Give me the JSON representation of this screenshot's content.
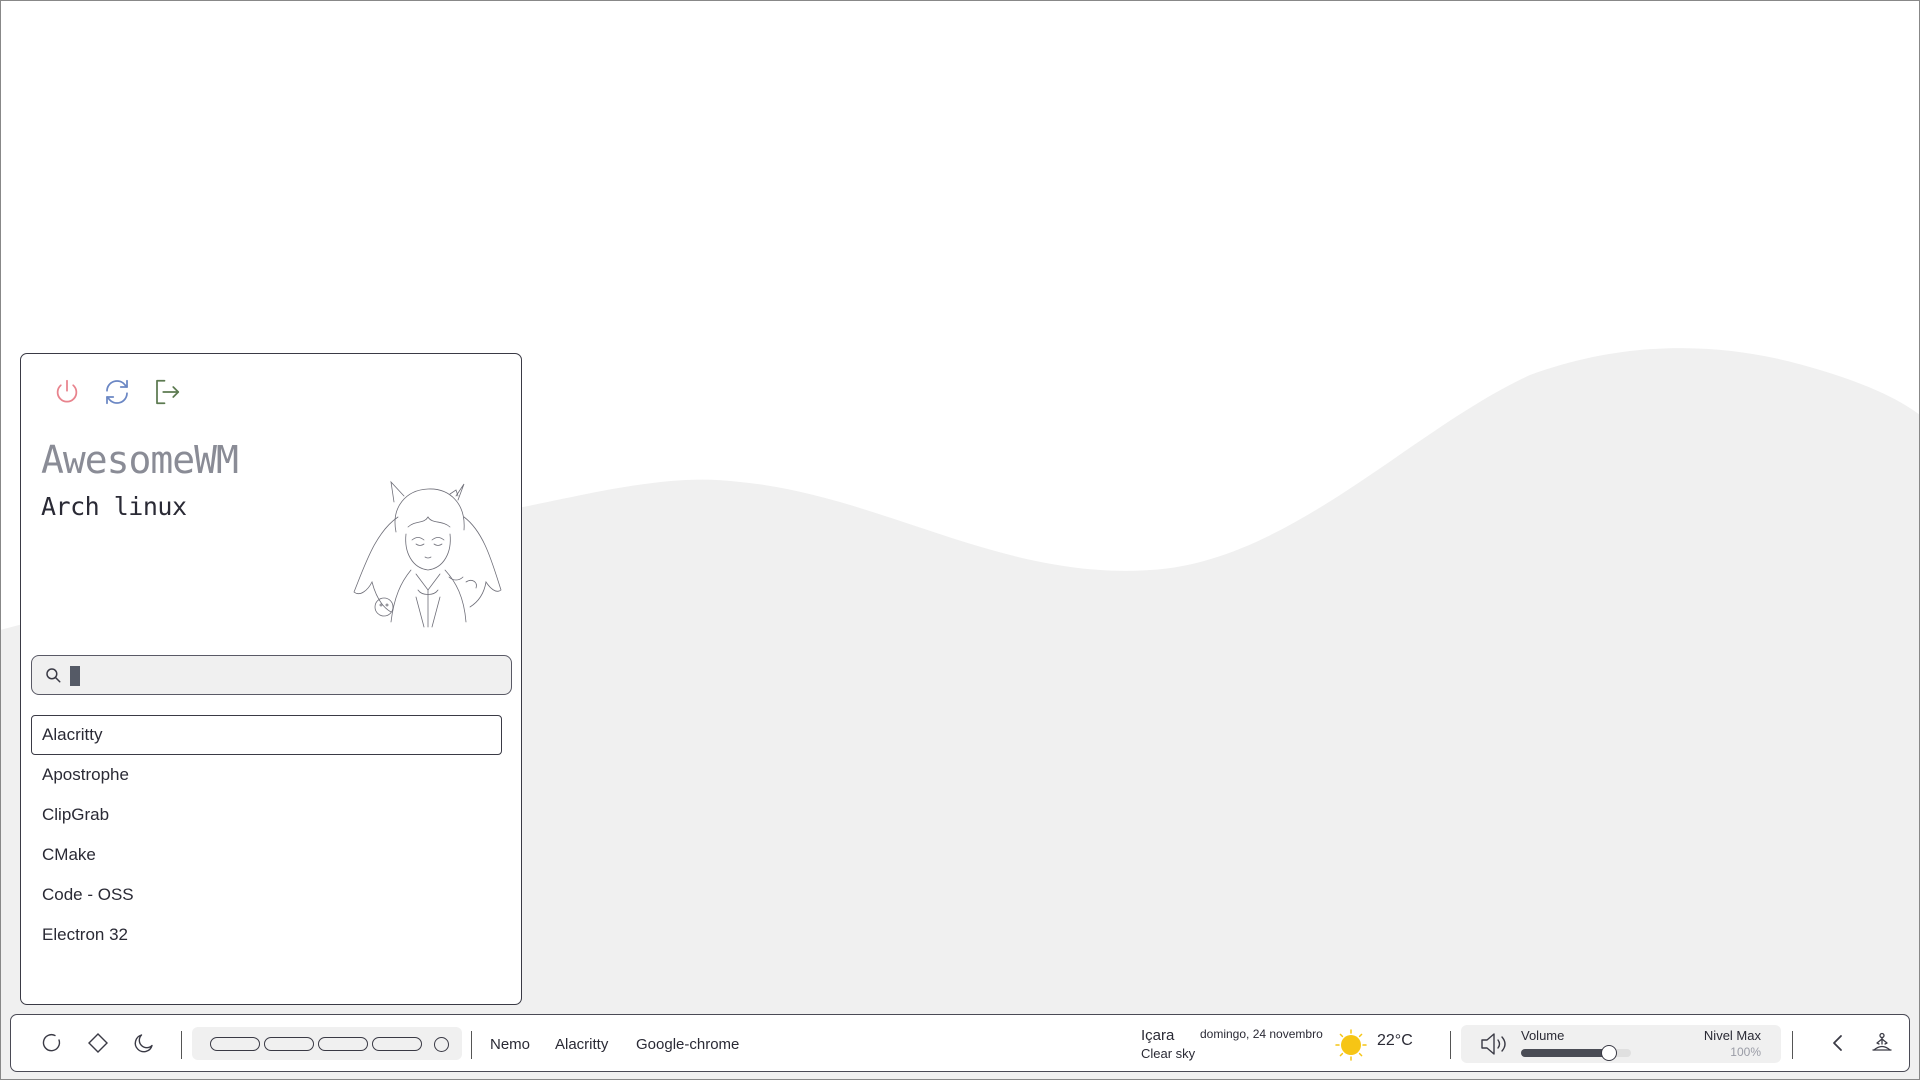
{
  "launcher": {
    "power_buttons": [
      {
        "icon": "power-icon",
        "color": "#e8838d"
      },
      {
        "icon": "refresh-icon",
        "color": "#6b87c4"
      },
      {
        "icon": "logout-icon",
        "color": "#5c7a50"
      }
    ],
    "title": "AwesomeWM",
    "subtitle": "Arch linux",
    "search": {
      "value": "",
      "placeholder": ""
    },
    "apps": [
      {
        "label": "Alacritty",
        "selected": true
      },
      {
        "label": "Apostrophe",
        "selected": false
      },
      {
        "label": "ClipGrab",
        "selected": false
      },
      {
        "label": "CMake",
        "selected": false
      },
      {
        "label": "Code - OSS",
        "selected": false
      },
      {
        "label": "Electron 32",
        "selected": false
      }
    ]
  },
  "taskbar": {
    "left_icons": [
      "circle-icon",
      "diamond-icon",
      "moon-icon"
    ],
    "tasks": [
      "Nemo",
      "Alacritty",
      "Google-chrome"
    ],
    "weather": {
      "city": "Içara",
      "description": "Clear sky",
      "temperature": "22°C",
      "icon": "sun-icon"
    },
    "date": "domingo, 24 novembro",
    "volume": {
      "label": "Volume",
      "max_label": "Nivel Max",
      "percent_text": "100%",
      "level": 0.8
    },
    "right_icons": [
      "chevron-left-icon",
      "meditate-icon"
    ]
  },
  "colors": {
    "accent": "#3a3a45",
    "wallpaper_wave": "#f0f0f0",
    "sun": "#f6c515"
  }
}
